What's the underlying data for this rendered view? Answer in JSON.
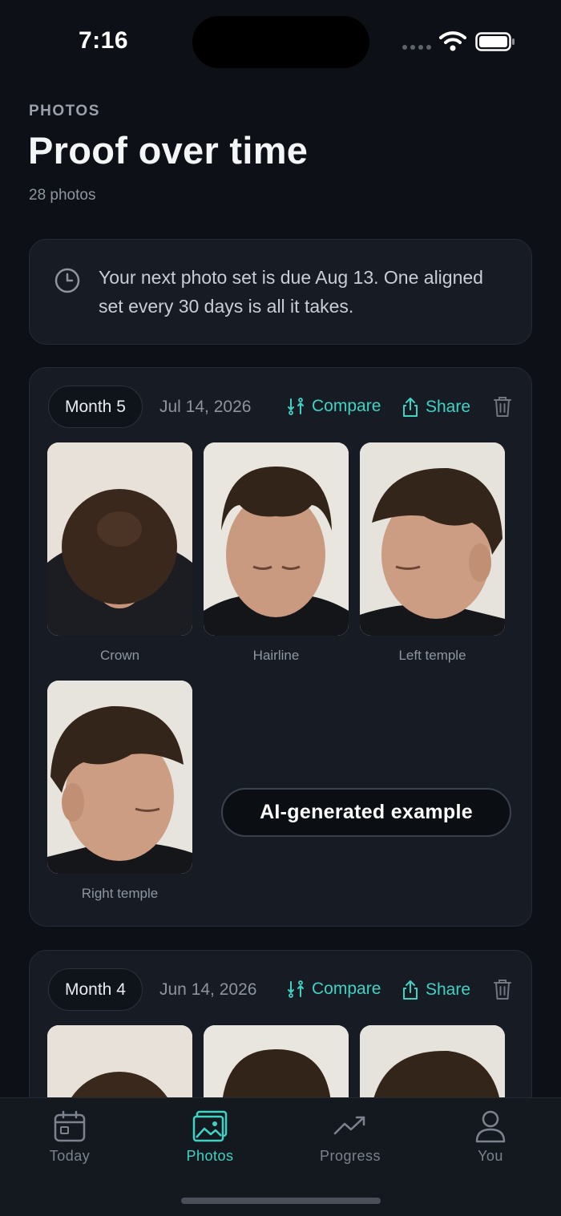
{
  "status": {
    "time": "7:16"
  },
  "header": {
    "eyebrow": "PHOTOS",
    "title": "Proof over time",
    "count": "28 photos"
  },
  "reminder": {
    "icon": "clock-icon",
    "text": "Your next photo set is due Aug 13. One aligned set every 30 days is all it takes."
  },
  "months": [
    {
      "label": "Month 5",
      "date": "Jul 14, 2026",
      "compare_label": "Compare",
      "share_label": "Share",
      "photos": [
        {
          "caption": "Crown"
        },
        {
          "caption": "Hairline"
        },
        {
          "caption": "Left temple"
        },
        {
          "caption": "Right temple"
        }
      ],
      "badge": "AI-generated example"
    },
    {
      "label": "Month 4",
      "date": "Jun 14, 2026",
      "compare_label": "Compare",
      "share_label": "Share"
    }
  ],
  "tabs": [
    {
      "label": "Today",
      "icon": "calendar-icon",
      "active": false
    },
    {
      "label": "Photos",
      "icon": "photos-icon",
      "active": true
    },
    {
      "label": "Progress",
      "icon": "trend-icon",
      "active": false
    },
    {
      "label": "You",
      "icon": "person-icon",
      "active": false
    }
  ],
  "colors": {
    "background": "#0d1117",
    "card": "#161b24",
    "accent": "#3fd3c4",
    "muted": "#8d949d"
  }
}
